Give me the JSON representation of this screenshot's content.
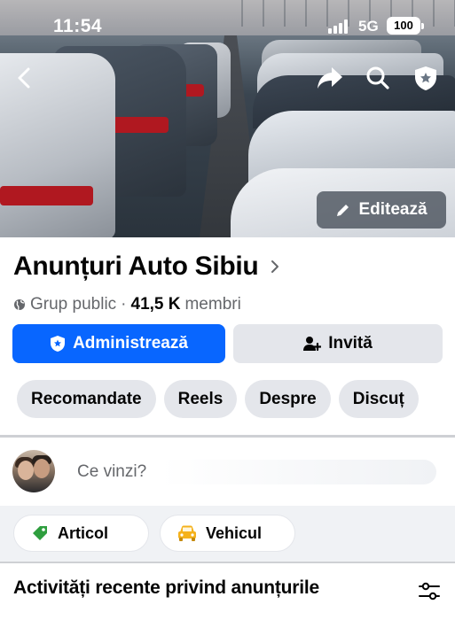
{
  "status_bar": {
    "time": "11:54",
    "network": "5G",
    "battery": "100"
  },
  "cover": {
    "edit_label": "Editează"
  },
  "group": {
    "name": "Anunțuri Auto Sibiu",
    "privacy": "Grup public",
    "separator": "·",
    "members_count": "41,5 K",
    "members_label": "membri"
  },
  "actions": {
    "admin_label": "Administrează",
    "invite_label": "Invită"
  },
  "tabs": [
    "Recomandate",
    "Reels",
    "Despre",
    "Discuț"
  ],
  "composer": {
    "placeholder": "Ce vinzi?"
  },
  "sell_options": {
    "article": "Articol",
    "vehicle": "Vehicul"
  },
  "sections": {
    "recent_title": "Activități recente privind anunțurile"
  },
  "colors": {
    "primary": "#0866ff",
    "chip": "#e4e6eb",
    "article_icon": "#2e9e3e",
    "vehicle_icon": "#f5b21c"
  }
}
